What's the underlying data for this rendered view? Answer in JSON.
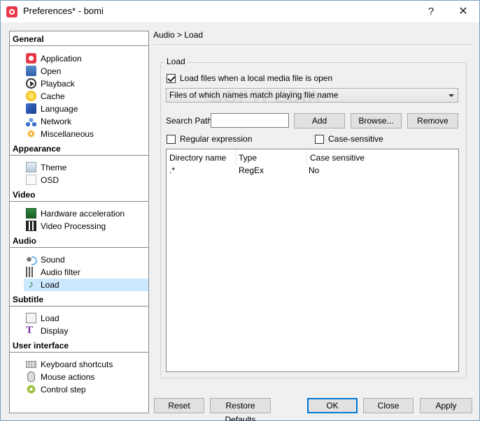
{
  "window": {
    "title": "Preferences* - bomi",
    "help_glyph": "?",
    "close_glyph": "✕"
  },
  "sidebar": {
    "sections": [
      {
        "label": "General",
        "items": [
          {
            "label": "Application",
            "icon": "application-icon"
          },
          {
            "label": "Open",
            "icon": "open-icon"
          },
          {
            "label": "Playback",
            "icon": "playback-icon"
          },
          {
            "label": "Cache",
            "icon": "cache-icon"
          },
          {
            "label": "Language",
            "icon": "language-icon"
          },
          {
            "label": "Network",
            "icon": "network-icon"
          },
          {
            "label": "Miscellaneous",
            "icon": "miscellaneous-icon"
          }
        ]
      },
      {
        "label": "Appearance",
        "items": [
          {
            "label": "Theme",
            "icon": "theme-icon"
          },
          {
            "label": "OSD",
            "icon": "osd-icon"
          }
        ]
      },
      {
        "label": "Video",
        "items": [
          {
            "label": "Hardware acceleration",
            "icon": "hardware-acceleration-icon"
          },
          {
            "label": "Video Processing",
            "icon": "video-processing-icon"
          }
        ]
      },
      {
        "label": "Audio",
        "items": [
          {
            "label": "Sound",
            "icon": "sound-icon"
          },
          {
            "label": "Audio filter",
            "icon": "audio-filter-icon"
          },
          {
            "label": "Load",
            "icon": "music-note-icon",
            "selected": true
          }
        ]
      },
      {
        "label": "Subtitle",
        "items": [
          {
            "label": "Load",
            "icon": "subtitle-load-icon"
          },
          {
            "label": "Display",
            "icon": "display-icon"
          }
        ]
      },
      {
        "label": "User interface",
        "items": [
          {
            "label": "Keyboard shortcuts",
            "icon": "keyboard-icon"
          },
          {
            "label": "Mouse actions",
            "icon": "mouse-icon"
          },
          {
            "label": "Control step",
            "icon": "control-step-icon"
          }
        ]
      }
    ],
    "selected_color": "#cce8ff"
  },
  "main": {
    "breadcrumb": "Audio > Load",
    "group_title": "Load",
    "load_checkbox": {
      "label": "Load files when a local media file is open",
      "checked": true
    },
    "mode_combo": {
      "value": "Files of which names match playing file name"
    },
    "search_path": {
      "label": "Search Path",
      "value": ""
    },
    "buttons": {
      "add": "Add",
      "browse": "Browse...",
      "remove": "Remove"
    },
    "regex_checkbox": {
      "label": "Regular expression",
      "checked": false
    },
    "case_checkbox": {
      "label": "Case-sensitive",
      "checked": false
    },
    "table": {
      "columns": [
        "Directory name",
        "Type",
        "Case sensitive"
      ],
      "rows": [
        [
          ".*",
          "RegEx",
          "No"
        ]
      ]
    }
  },
  "footer": {
    "reset": "Reset",
    "restore_defaults": "Restore Defaults",
    "ok": "OK",
    "close": "Close",
    "apply": "Apply"
  },
  "watermark": "SOFTPEDIA"
}
